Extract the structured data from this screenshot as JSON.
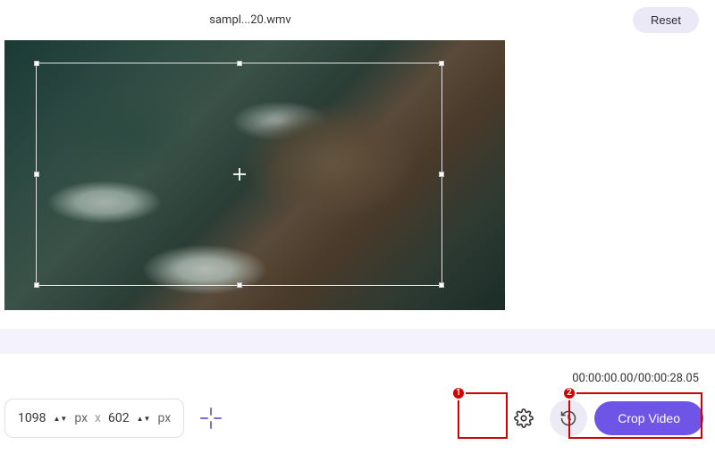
{
  "header": {
    "filename": "sampl...20.wmv",
    "reset_label": "Reset"
  },
  "crop": {
    "width_value": "1098",
    "height_value": "602",
    "unit": "px",
    "separator": "x"
  },
  "time": {
    "current": "00:00:00.00",
    "total": "00:00:28.05"
  },
  "actions": {
    "crop_label": "Crop Video"
  },
  "annotations": {
    "badge1": "1",
    "badge2": "2"
  }
}
